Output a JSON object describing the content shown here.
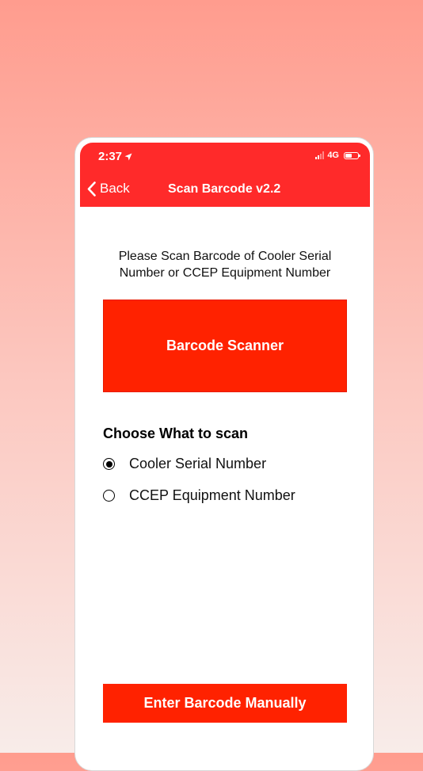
{
  "status_bar": {
    "time": "2:37",
    "network": "4G"
  },
  "nav": {
    "back_label": "Back",
    "title": "Scan Barcode v2.2"
  },
  "instructions": "Please Scan Barcode of Cooler Serial Number or CCEP Equipment Number",
  "scanner_button_label": "Barcode Scanner",
  "choose_heading": "Choose What to scan",
  "options": [
    {
      "label": "Cooler Serial Number",
      "selected": true
    },
    {
      "label": "CCEP Equipment Number",
      "selected": false
    }
  ],
  "manual_button_label": "Enter Barcode Manually",
  "colors": {
    "accent": "#ff2200",
    "header": "#ff2a2a"
  },
  "battery_level": 0.5
}
